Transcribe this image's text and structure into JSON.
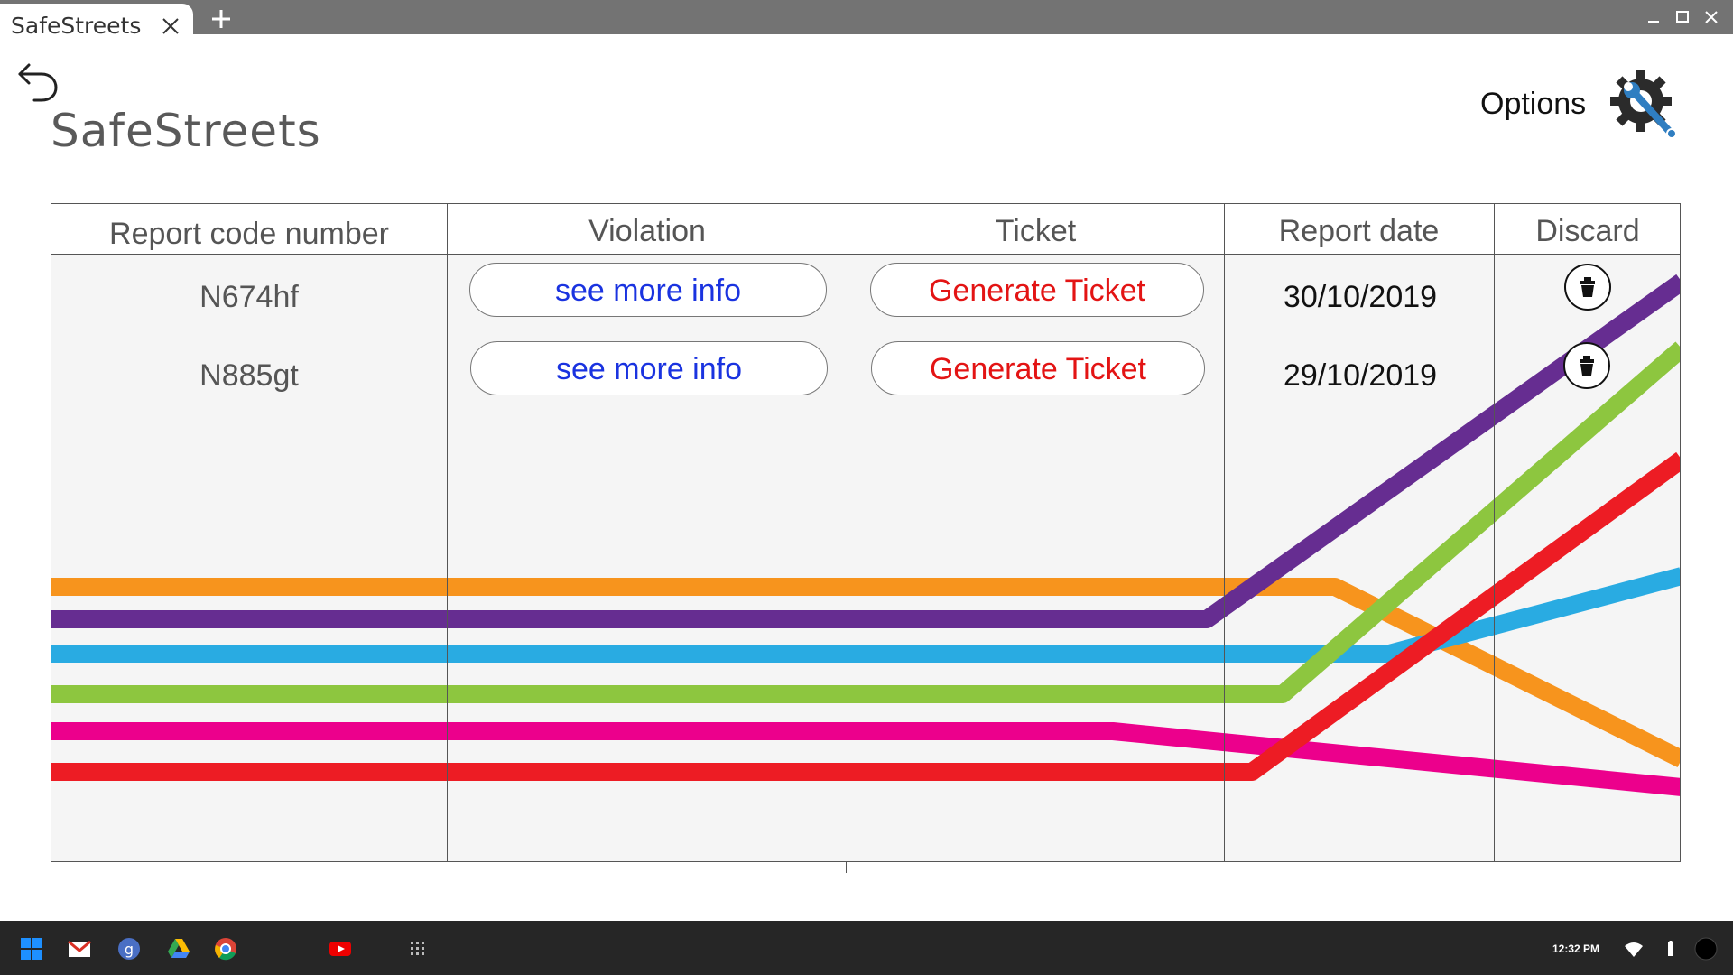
{
  "window": {
    "tab_title": "SafeStreets"
  },
  "header": {
    "app_title": "SafeStreets",
    "options_label": "Options"
  },
  "table": {
    "columns": [
      "Report code number",
      "Violation",
      "Ticket",
      "Report date",
      "Discard"
    ],
    "rows": [
      {
        "code": "N674hf",
        "info_label": "see more info",
        "ticket_label": "Generate Ticket",
        "date": "30/10/2019"
      },
      {
        "code": "N885gt",
        "info_label": "see more info",
        "ticket_label": "Generate Ticket",
        "date": "29/10/2019"
      }
    ]
  },
  "decorative_lines": {
    "colors": [
      "#f7941d",
      "#662d91",
      "#29abe2",
      "#8dc63f",
      "#ec008c",
      "#ed1c24"
    ]
  },
  "taskbar": {
    "clock": "12:32 PM",
    "icons": [
      "windows-start-icon",
      "gmail-icon",
      "google-icon",
      "drive-icon",
      "chrome-icon",
      "youtube-icon",
      "app-launcher-icon",
      "wifi-icon",
      "battery-icon",
      "account-icon"
    ]
  },
  "colors": {
    "titlebar": "#737373",
    "taskbar": "#262626",
    "info_text": "#1a33e0",
    "ticket_text": "#e31414",
    "options_icon_blue": "#2f7ec1"
  }
}
